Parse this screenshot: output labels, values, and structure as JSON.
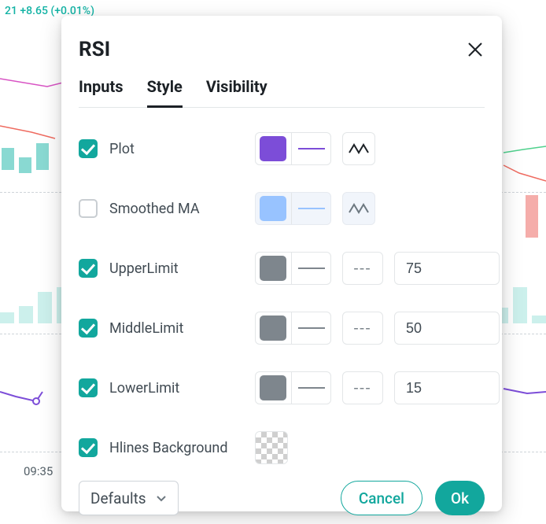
{
  "bg": {
    "price_text": "21 +8.65 (+0.01%)",
    "time_label": "09:35"
  },
  "dialog": {
    "title": "RSI",
    "tabs": {
      "inputs": "Inputs",
      "style": "Style",
      "visibility": "Visibility",
      "active": "style"
    },
    "rows": {
      "plot": {
        "label": "Plot",
        "checked": true,
        "color": "#7c4dd8",
        "line": "solid",
        "enabled": true
      },
      "smoothed_ma": {
        "label": "Smoothed MA",
        "checked": false,
        "color": "#98c3ff",
        "line": "solid",
        "enabled": false
      },
      "upper": {
        "label": "UpperLimit",
        "checked": true,
        "color": "#7e868d",
        "dash": "---",
        "value": "75"
      },
      "middle": {
        "label": "MiddleLimit",
        "checked": true,
        "color": "#7e868d",
        "dash": "---",
        "value": "50"
      },
      "lower": {
        "label": "LowerLimit",
        "checked": true,
        "color": "#7e868d",
        "dash": "---",
        "value": "15"
      },
      "hlines": {
        "label": "Hlines Background",
        "checked": true
      }
    },
    "footer": {
      "defaults": "Defaults",
      "cancel": "Cancel",
      "ok": "Ok"
    }
  }
}
